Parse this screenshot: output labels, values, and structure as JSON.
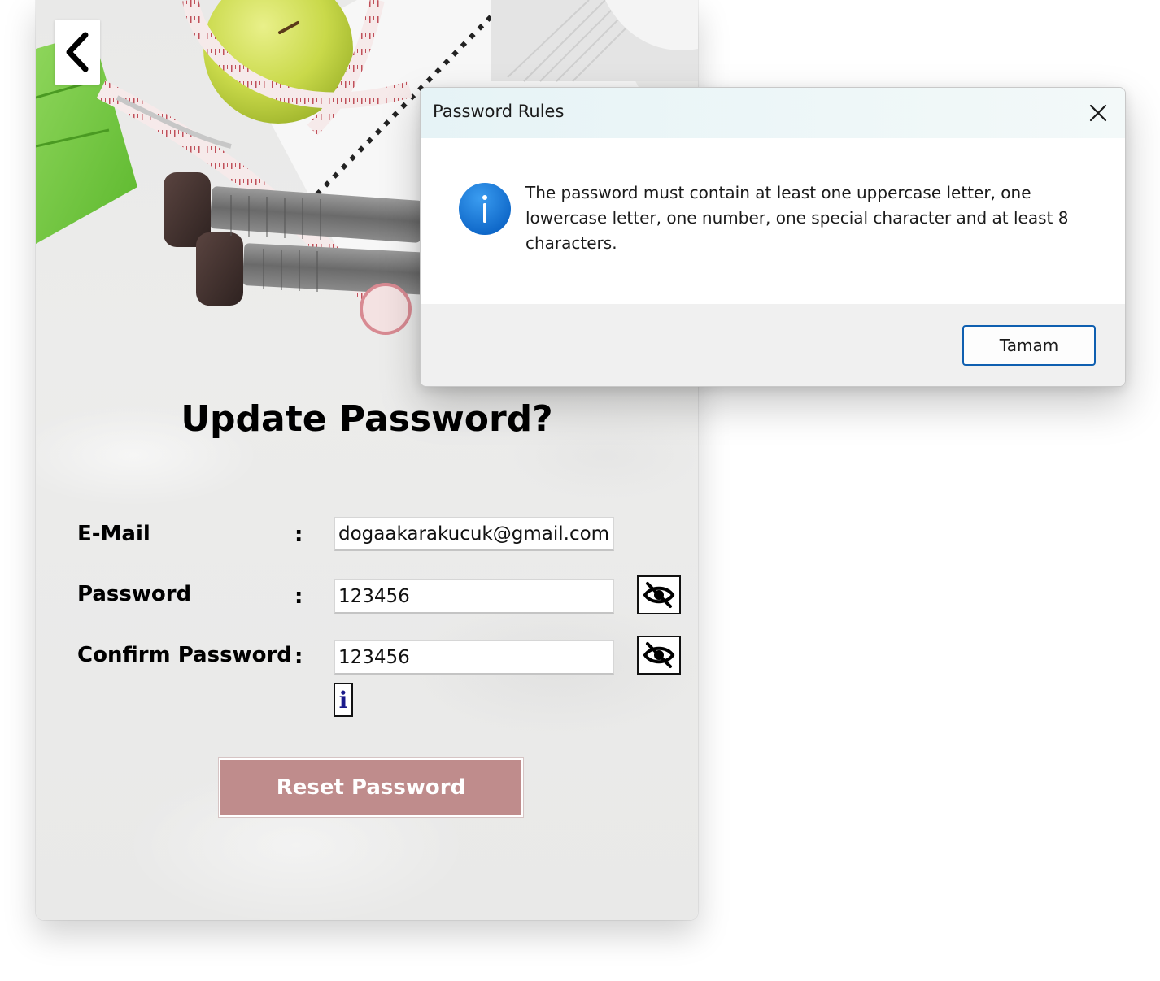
{
  "app": {
    "page_title": "Update Password?",
    "colon": ":",
    "form": {
      "email": {
        "label": "E-Mail",
        "value": "dogaakarakucuk@gmail.com"
      },
      "password": {
        "label": "Password",
        "value": "123456"
      },
      "confirm_password": {
        "label": "Confirm Password",
        "value": "123456"
      }
    },
    "info_button_glyph": "i",
    "reset_button_label": "Reset Password",
    "colors": {
      "reset_button": "#bf8c8c",
      "info_glyph": "#1a1a8c"
    },
    "icons": {
      "back": "chevron-left-icon",
      "password_toggle": "eye-slash-icon",
      "confirm_toggle": "eye-slash-icon",
      "info": "info-icon"
    }
  },
  "dialog": {
    "title": "Password Rules",
    "message": "The password must contain at least one uppercase letter, one lowercase letter, one number, one special character and at least 8 characters.",
    "ok_label": "Tamam",
    "icons": {
      "close": "close-icon",
      "message": "info-circle-icon"
    },
    "colors": {
      "info_icon": "#1a73d8",
      "ok_border": "#0f5fb0"
    }
  }
}
